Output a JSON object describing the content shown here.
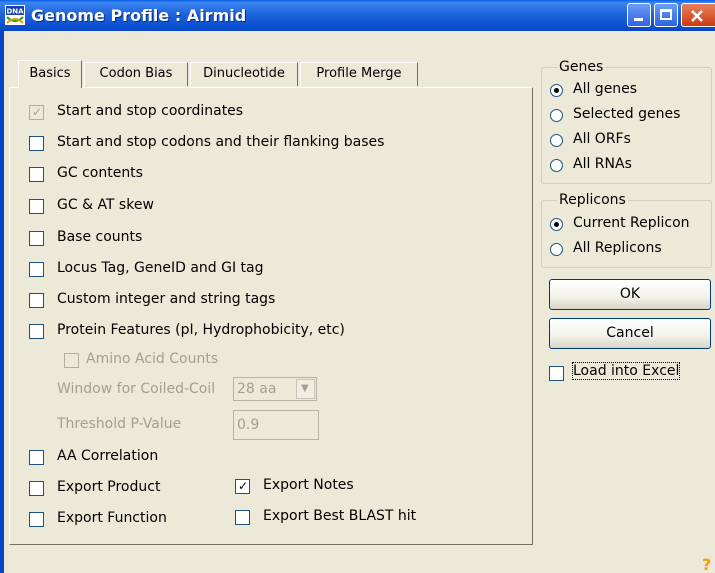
{
  "window": {
    "app_icon": "dna-icon",
    "title": "Genome Profile : Airmid",
    "controls": [
      "minimize",
      "maximize",
      "close"
    ]
  },
  "tabs": [
    "Basics",
    "Codon Bias",
    "Dinucleotide",
    "Profile Merge"
  ],
  "active_tab": "Basics",
  "options": {
    "start_stop_coordinates": "Start and stop coordinates",
    "start_stop_codons": "Start and stop codons and their flanking bases",
    "gc_contents": "GC contents",
    "gc_at_skew": "GC & AT skew",
    "base_counts": "Base counts",
    "locus_tag": "Locus Tag, GeneID and GI tag",
    "custom_tags": "Custom integer and string tags",
    "protein_features": "Protein Features (pI, Hydrophobicity, etc)",
    "amino_acid_counts": "Amino Acid Counts",
    "window_coiled_coil_label": "Window for Coiled-Coil",
    "window_coiled_coil_value": "28 aa",
    "threshold_pvalue_label": "Threshold P-Value",
    "threshold_pvalue_value": "0.9",
    "aa_correlation": "AA Correlation",
    "export_product": "Export Product",
    "export_notes": "Export Notes",
    "export_function": "Export Function",
    "export_best_blast": "Export Best BLAST hit"
  },
  "checked": {
    "start_stop_coordinates": true,
    "export_notes": true
  },
  "genes": {
    "legend": "Genes",
    "options": [
      "All genes",
      "Selected genes",
      "All ORFs",
      "All RNAs"
    ],
    "selected": "All genes"
  },
  "replicons": {
    "legend": "Replicons",
    "options": [
      "Current Replicon",
      "All Replicons"
    ],
    "selected": "Current Replicon"
  },
  "buttons": {
    "ok": "OK",
    "cancel": "Cancel"
  },
  "load_into_excel": "Load into Excel",
  "help_glyph": "?",
  "colors": {
    "titlebar": "#0a4fd0",
    "dialog_bg": "#ece9d8",
    "close_button": "#cc3a10"
  }
}
